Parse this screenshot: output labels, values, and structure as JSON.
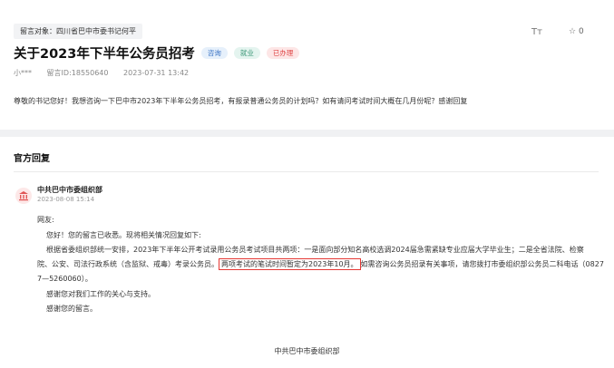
{
  "message": {
    "target_label": "留言对象：四川省巴中市委书记何平",
    "title": "关于2023年下半年公务员招考",
    "tags": [
      "咨询",
      "就业",
      "已办理"
    ],
    "author": "小***",
    "message_id": "留言ID:18550640",
    "datetime": "2023-07-31 13:42",
    "content": "尊敬的书记您好！我想咨询一下巴中市2023年下半年公务员招考，有报录普通公务员的计划吗？如有请问考试时间大概在几月份呢？感谢回复"
  },
  "toolbar": {
    "font_icon_glyph": "Tт",
    "like_count": "0"
  },
  "official_reply": {
    "section_title": "官方回复",
    "org_name": "中共巴中市委组织部",
    "datetime": "2023-08-08 15:14",
    "greeting": "网友:",
    "line1": "您好！您的留言已收悉。现将相关情况回复如下:",
    "line2": "根据省委组织部统一安排，2023年下半年公开考试录用公务员考试项目共两项：一是面向部分知名高校选调2024届急需紧缺专业应届大学毕业生；二是全省法院、检察",
    "line3_pre": "院、公安、司法行政系统（含监狱、戒毒）考录公务员。",
    "line3_highlight": "两项考试的笔试时间暂定为2023年10月。",
    "line3_post": "如需咨询公务员招录有关事项，请您拨打市委组织部公务员二科电话（0827",
    "line4": "7—5260060）。",
    "line5": "感谢您对我们工作的关心与支持。",
    "line6": "感谢您的留言。",
    "signature": "中共巴中市委组织部"
  },
  "colors": {
    "tag_blue": "#3b74c5",
    "tag_green": "#3a9676",
    "tag_red": "#e04848",
    "highlight_border": "#e53935",
    "avatar_icon": "#e05555"
  }
}
